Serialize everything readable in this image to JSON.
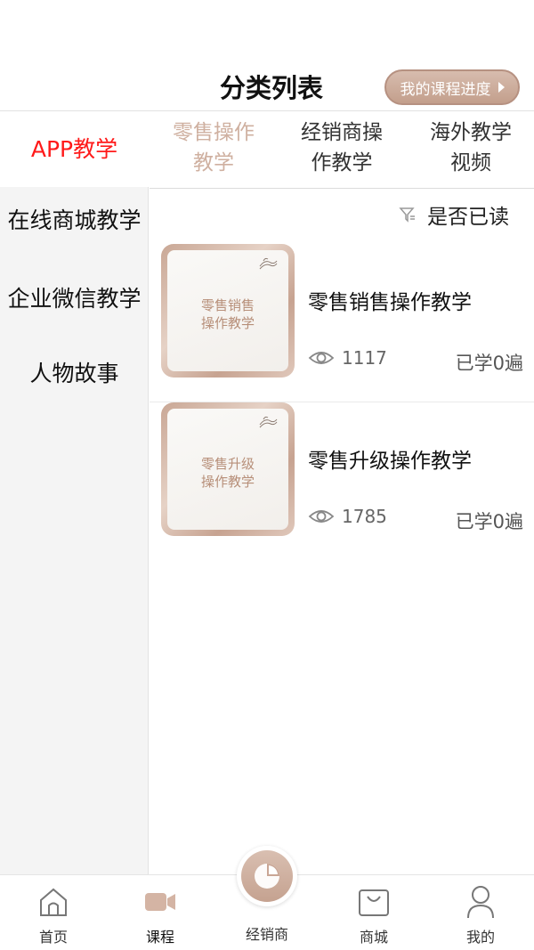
{
  "header": {
    "title": "分类列表",
    "progress_button": "我的课程进度"
  },
  "sidebar": {
    "items": [
      {
        "label": "APP教学",
        "active": true
      },
      {
        "label": "在线商城教学",
        "active": false
      },
      {
        "label": "企业微信教学",
        "active": false
      },
      {
        "label": "人物故事",
        "active": false
      }
    ]
  },
  "tabs": [
    {
      "line1": "零售操作",
      "line2": "教学",
      "active": true
    },
    {
      "line1": "经销商操",
      "line2": "作教学",
      "active": false
    },
    {
      "line1": "海外教学",
      "line2": "视频",
      "active": false
    }
  ],
  "filter": {
    "label": "是否已读",
    "icon": "filter-icon"
  },
  "courses": [
    {
      "thumb_line1": "零售销售",
      "thumb_line2": "操作教学",
      "title": "零售销售操作教学",
      "views": "1117",
      "learned": "已学0遍"
    },
    {
      "thumb_line1": "零售升级",
      "thumb_line2": "操作教学",
      "title": "零售升级操作教学",
      "views": "1785",
      "learned": "已学0遍"
    }
  ],
  "bottom_nav": [
    {
      "label": "首页",
      "icon": "home-icon"
    },
    {
      "label": "课程",
      "icon": "video-camera-icon",
      "active": true
    },
    {
      "label": "经销商",
      "icon": "pie-chart-icon"
    },
    {
      "label": "商城",
      "icon": "shopping-bag-icon"
    },
    {
      "label": "我的",
      "icon": "user-icon"
    }
  ],
  "colors": {
    "accent": "#c9a695",
    "active_sidebar": "#ff1a1a",
    "active_tab": "#cfb0a0"
  }
}
